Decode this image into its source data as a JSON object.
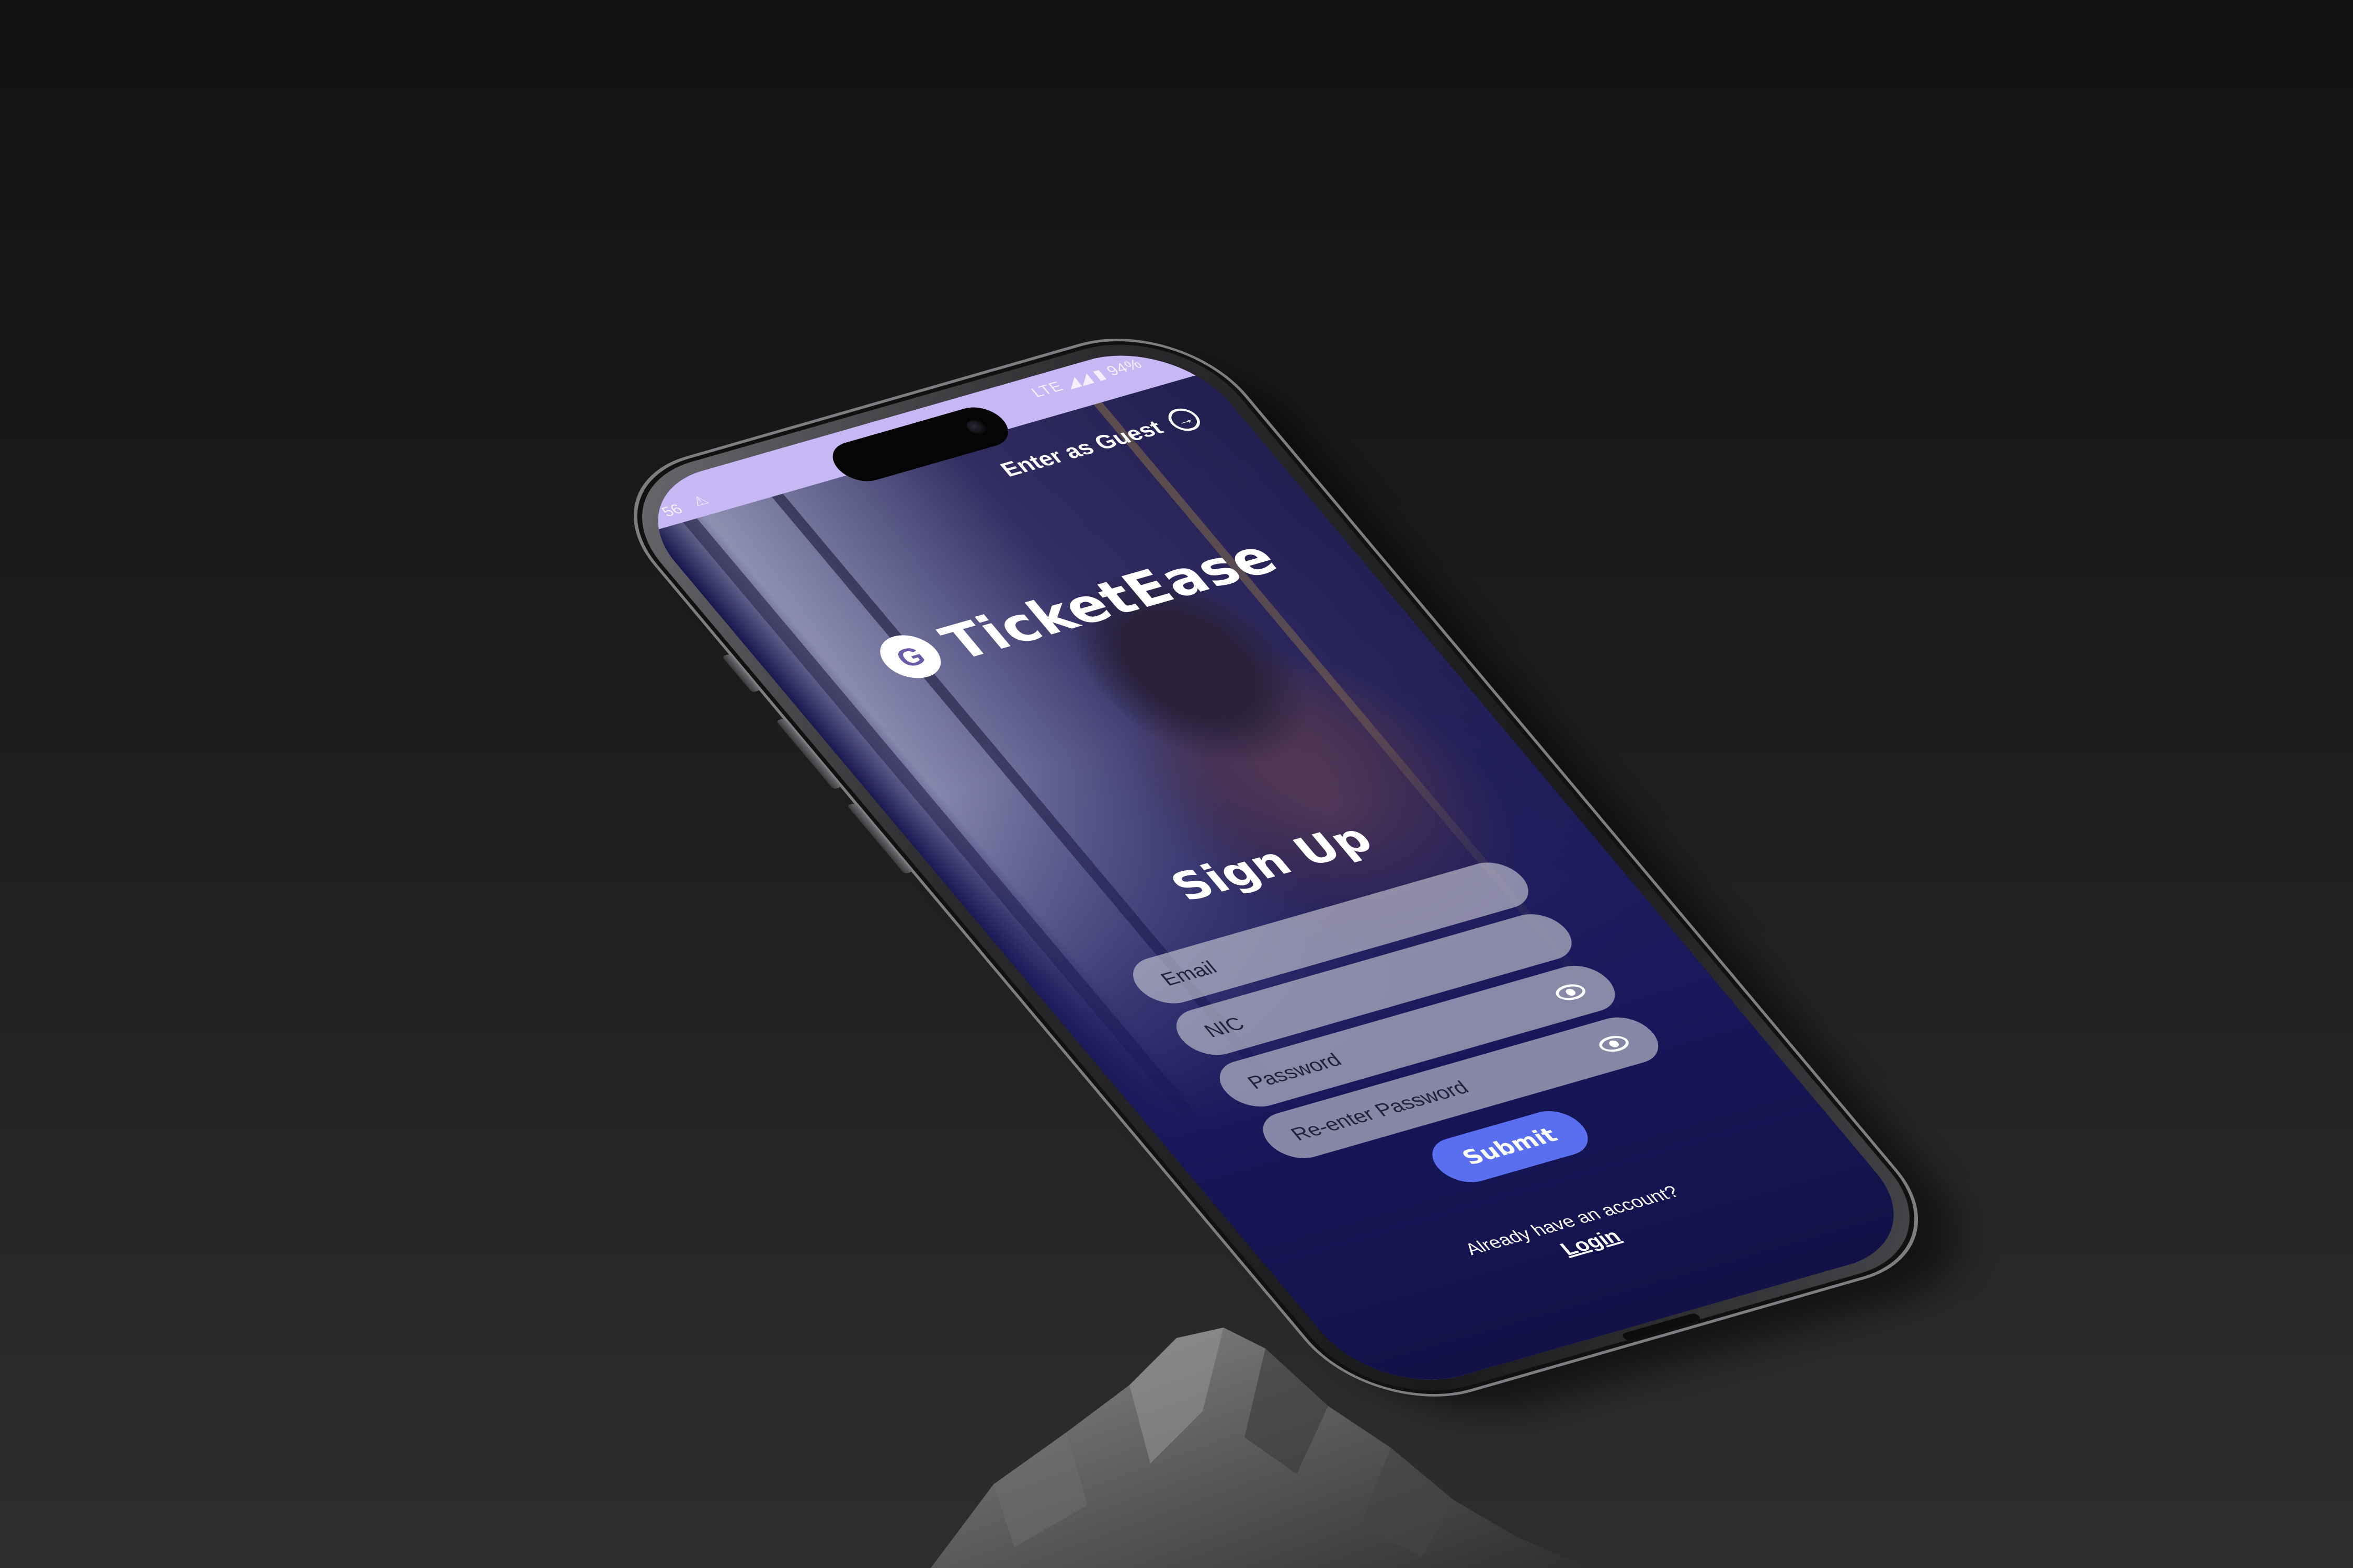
{
  "status_bar": {
    "time": "56",
    "warning_icon": "warning-triangle-icon",
    "network": "LTE",
    "signal_icons": "◢◢",
    "battery_icon": "battery-icon",
    "battery": "94%",
    "background_color": "#c7b8f5"
  },
  "header": {
    "guest_label": "Enter as Guest",
    "guest_icon": "arrow-right-circle-icon"
  },
  "brand": {
    "logo_letter": "G",
    "name": "TicketEase"
  },
  "form": {
    "title": "Sign Up",
    "fields": [
      {
        "label": "Email",
        "has_eye": false
      },
      {
        "label": "NIC",
        "has_eye": false
      },
      {
        "label": "Password",
        "has_eye": true,
        "eye_icon": "eye-icon"
      },
      {
        "label": "Re-enter Password",
        "has_eye": true,
        "eye_icon": "eye-icon"
      }
    ],
    "submit_label": "Submit",
    "submit_color": "#5a6ef0",
    "account_prompt": "Already have an account?",
    "login_label": "Login"
  },
  "colors": {
    "screen_bottom": "#121248",
    "field_background": "rgba(205,205,215,0.62)"
  }
}
